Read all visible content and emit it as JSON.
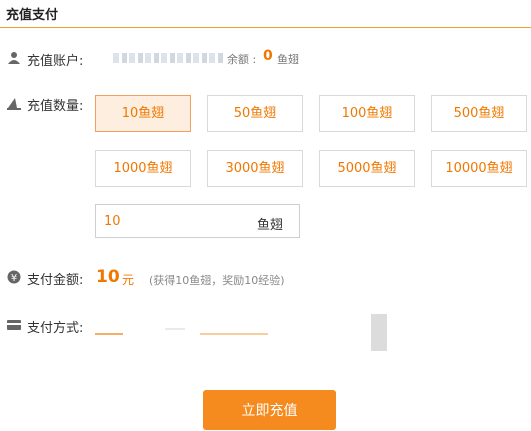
{
  "header": {
    "title": "充值支付"
  },
  "account": {
    "label": "充值账户:",
    "balance_label": "余额 :",
    "balance_value": "0",
    "balance_unit": "鱼翅"
  },
  "quantity": {
    "label": "充值数量:",
    "options": [
      "10鱼翅",
      "50鱼翅",
      "100鱼翅",
      "500鱼翅",
      "1000鱼翅",
      "3000鱼翅",
      "5000鱼翅",
      "10000鱼翅"
    ],
    "selected_index": 0,
    "custom_value": "10",
    "custom_unit": "鱼翅"
  },
  "payment": {
    "label": "支付金额:",
    "value": "10",
    "unit": "元",
    "note": "(获得10鱼翅，奖励10经验)"
  },
  "method": {
    "label": "支付方式:"
  },
  "submit": {
    "label": "立即充值"
  },
  "colors": {
    "accent": "#f07800",
    "button": "#f58a1f",
    "header_border": "#f0a030"
  }
}
